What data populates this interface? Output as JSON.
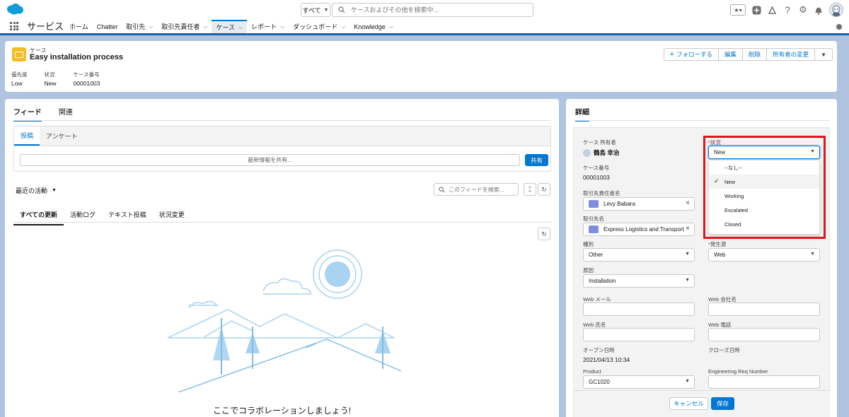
{
  "colors": {
    "brand": "#0176d3",
    "nav_accent": "#1b5fa8",
    "case_icon": "#f4bc25",
    "highlight_box": "#e3141b",
    "background": "#b0c4df"
  },
  "global_header": {
    "search_scope": "すべて",
    "search_placeholder": "ケースおよびその他を検索中..."
  },
  "nav": {
    "app_name": "サービス",
    "items": [
      {
        "label": "ホーム",
        "has_menu": false,
        "active": false
      },
      {
        "label": "Chatter",
        "has_menu": false,
        "active": false
      },
      {
        "label": "取引先",
        "has_menu": true,
        "active": false
      },
      {
        "label": "取引先責任者",
        "has_menu": true,
        "active": false
      },
      {
        "label": "ケース",
        "has_menu": true,
        "active": true
      },
      {
        "label": "レポート",
        "has_menu": true,
        "active": false
      },
      {
        "label": "ダッシュボード",
        "has_menu": true,
        "active": false
      },
      {
        "label": "Knowledge",
        "has_menu": true,
        "active": false
      }
    ]
  },
  "record": {
    "object_label": "ケース",
    "title": "Easy installation process",
    "actions": {
      "follow": "フォローする",
      "edit": "編集",
      "delete": "削除",
      "change_owner": "所有者の変更"
    },
    "highlights": [
      {
        "label": "優先度",
        "value": "Low"
      },
      {
        "label": "状況",
        "value": "New"
      },
      {
        "label": "ケース番号",
        "value": "00001003"
      }
    ]
  },
  "feed": {
    "tabs": [
      "フィード",
      "関連"
    ],
    "publisher_tabs": [
      "投稿",
      "アンケート"
    ],
    "share_placeholder": "最新情報を共有...",
    "share_button": "共有",
    "sort_label": "最近の活動",
    "search_placeholder": "このフィードを検索...",
    "filter_tabs": [
      "すべての更新",
      "活動ログ",
      "テキスト投稿",
      "状況変更"
    ],
    "empty_message": "ここでコラボレーションしましょう!"
  },
  "details": {
    "tab": "詳細",
    "owner": {
      "label": "ケース 所有者",
      "value": "鶴島 幸治"
    },
    "case_number": {
      "label": "ケース番号",
      "value": "00001003"
    },
    "contact": {
      "label": "取引先責任者名",
      "value": "Levy Babara"
    },
    "account": {
      "label": "取引先名",
      "value": "Express Logistics and Transport"
    },
    "type": {
      "label": "種別",
      "value": "Other"
    },
    "reason": {
      "label": "原因",
      "value": "Installation"
    },
    "web_email": {
      "label": "Web メール",
      "value": ""
    },
    "web_name": {
      "label": "Web 氏名",
      "value": ""
    },
    "opened": {
      "label": "オープン日時",
      "value": "2021/04/13 10:34"
    },
    "product": {
      "label": "Product",
      "value": "GC1020"
    },
    "status": {
      "label": "状況",
      "value": "New",
      "options": [
        {
          "label": "--なし--",
          "selected": false
        },
        {
          "label": "New",
          "selected": true
        },
        {
          "label": "Working",
          "selected": false
        },
        {
          "label": "Escalated",
          "selected": false
        },
        {
          "label": "Closed",
          "selected": false
        }
      ]
    },
    "origin": {
      "label": "発生源",
      "value": "Web"
    },
    "web_company": {
      "label": "Web 会社名",
      "value": ""
    },
    "web_phone": {
      "label": "Web 電話",
      "value": ""
    },
    "closed": {
      "label": "クローズ日時",
      "value": ""
    },
    "eng_req": {
      "label": "Engineering Req Number",
      "value": ""
    },
    "cancel": "キャンセル",
    "save": "保存"
  }
}
